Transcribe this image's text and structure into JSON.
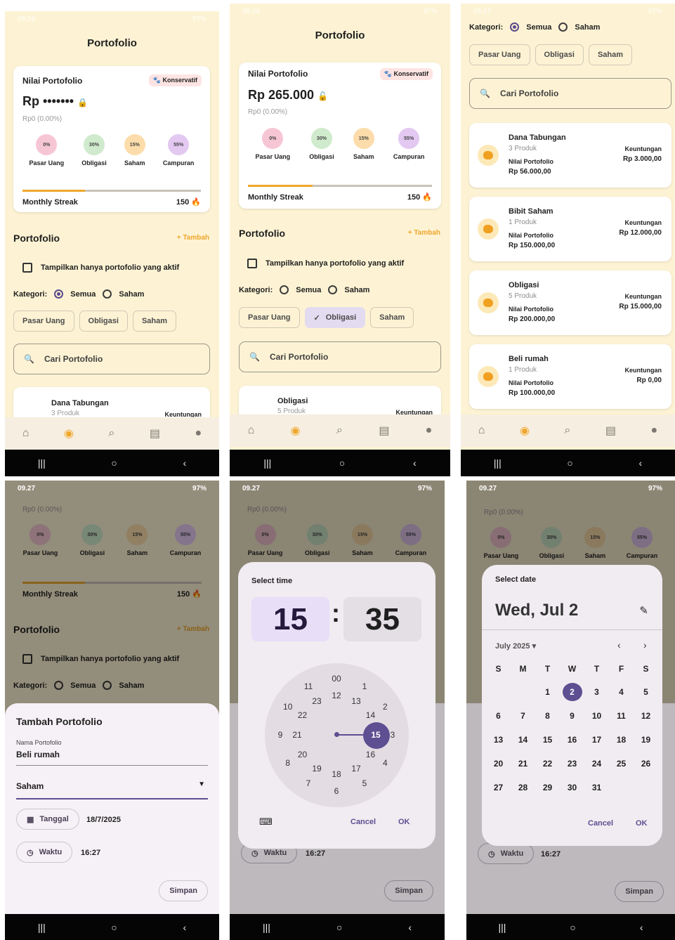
{
  "status": {
    "time": "09.26",
    "time2": "09.27",
    "battery": "97%",
    "icons": "▣ ≈ G"
  },
  "app": {
    "title": "Portofolio"
  },
  "summary": {
    "label": "Nilai Portofolio",
    "badge": "Konservatif",
    "value_hidden": "Rp •••••••",
    "value_shown": "Rp 265.000",
    "change": "Rp0 (0.00%)",
    "allocations": [
      {
        "pct": "0%",
        "name": "Pasar Uang",
        "color": "#f7c6d5"
      },
      {
        "pct": "30%",
        "name": "Obligasi",
        "color": "#cfeacc"
      },
      {
        "pct": "15%",
        "name": "Saham",
        "color": "#fcdcaa"
      },
      {
        "pct": "55%",
        "name": "Campuran",
        "color": "#e3c8f1"
      }
    ],
    "streak_label": "Monthly Streak",
    "streak_value": "150",
    "streak_progress": 0.35
  },
  "section": {
    "title": "Portofolio",
    "add": "+ Tambah",
    "filter_active": "Tampilkan hanya portofolio yang aktif"
  },
  "filters": {
    "label": "Kategori:",
    "opt1": "Semua",
    "opt2": "Saham",
    "chips": [
      "Pasar Uang",
      "Obligasi",
      "Saham"
    ]
  },
  "search": {
    "placeholder": "Cari Portofolio"
  },
  "portfolios": [
    {
      "name": "Dana Tabungan",
      "count": "3 Produk",
      "val_label": "Nilai Portofolio",
      "value": "Rp 56.000,00",
      "gain_label": "Keuntungan",
      "gain": "Rp 3.000,00"
    },
    {
      "name": "Bibit Saham",
      "count": "1 Produk",
      "val_label": "Nilai Portofolio",
      "value": "Rp 150.000,00",
      "gain_label": "Keuntungan",
      "gain": "Rp 12.000,00"
    },
    {
      "name": "Obligasi",
      "count": "5 Produk",
      "val_label": "Nilai Portofolio",
      "value": "Rp 200.000,00",
      "gain_label": "Keuntungan",
      "gain": "Rp 15.000,00"
    },
    {
      "name": "Beli rumah",
      "count": "1 Produk",
      "val_label": "Nilai Portofolio",
      "value": "Rp 100.000,00",
      "gain_label": "Keuntungan",
      "gain": "Rp 0,00"
    }
  ],
  "add_sheet": {
    "title": "Tambah Portofolio",
    "name_label": "Nama Portofolio",
    "name_value": "Beli rumah",
    "category": "Saham",
    "date_btn": "Tanggal",
    "date_value": "18/7/2025",
    "time_btn": "Waktu",
    "time_value": "16:27",
    "save": "Simpan"
  },
  "time_picker": {
    "title": "Select time",
    "hour": "15",
    "minute": "35",
    "cancel": "Cancel",
    "ok": "OK",
    "outer": [
      "00",
      "1",
      "2",
      "3",
      "4",
      "5",
      "6",
      "7",
      "8",
      "9",
      "10",
      "11"
    ],
    "inner": [
      "12",
      "13",
      "14",
      "15",
      "16",
      "17",
      "18",
      "19",
      "20",
      "21",
      "22",
      "23"
    ]
  },
  "date_picker": {
    "title": "Select date",
    "heading": "Wed, Jul 2",
    "month": "July 2025",
    "cancel": "Cancel",
    "ok": "OK",
    "weekdays": [
      "S",
      "M",
      "T",
      "W",
      "T",
      "F",
      "S"
    ],
    "days": [
      "",
      "",
      "1",
      "2",
      "3",
      "4",
      "5",
      "6",
      "7",
      "8",
      "9",
      "10",
      "11",
      "12",
      "13",
      "14",
      "15",
      "16",
      "17",
      "18",
      "19",
      "20",
      "21",
      "22",
      "23",
      "24",
      "25",
      "26",
      "27",
      "28",
      "29",
      "30",
      "31"
    ],
    "selected": "2"
  }
}
